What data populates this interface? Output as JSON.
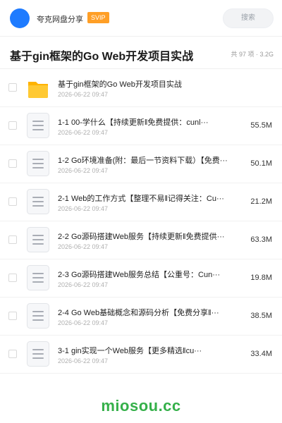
{
  "header": {
    "app_name": "夸克网盘分享",
    "badge": "SVIP",
    "search_placeholder": "搜索"
  },
  "share": {
    "title": "基于gin框架的Go Web开发项目实战",
    "summary": "共 97 项 · 3.2G"
  },
  "files": [
    {
      "type": "folder",
      "icon": "folder-icon",
      "name": "基于gin框架的Go Web开发项目实战",
      "date": "2026-06-22 09:47",
      "size": ""
    },
    {
      "type": "doc",
      "icon": "document-icon",
      "name": "1-1 00-学什么【持续更新‖免费提供：cunl···",
      "date": "2026-06-22 09:47",
      "size": "55.5M"
    },
    {
      "type": "doc",
      "icon": "document-icon",
      "name": "1-2 Go环境准备(附：最后一节资料下载）【免费···",
      "date": "2026-06-22 09:47",
      "size": "50.1M"
    },
    {
      "type": "doc",
      "icon": "document-icon",
      "name": "2-1 Web的工作方式【整理不易‖记得关注：Cu···",
      "date": "2026-06-22 09:47",
      "size": "21.2M"
    },
    {
      "type": "doc",
      "icon": "document-icon",
      "name": "2-2 Go源码搭建Web服务【持续更新‖免费提供···",
      "date": "2026-06-22 09:47",
      "size": "63.3M"
    },
    {
      "type": "doc",
      "icon": "document-icon",
      "name": "2-3 Go源码搭建Web服务总结【公重号：Cun···",
      "date": "2026-06-22 09:47",
      "size": "19.8M"
    },
    {
      "type": "doc",
      "icon": "document-icon",
      "name": "2-4 Go Web基础概念和源码分析【免费分享‖···",
      "date": "2026-06-22 09:47",
      "size": "38.5M"
    },
    {
      "type": "doc",
      "icon": "document-icon",
      "name": "3-1 gin实现一个Web服务【更多精选‖cu···",
      "date": "2026-06-22 09:47",
      "size": "33.4M"
    }
  ],
  "watermark": "miosou.cc",
  "colors": {
    "accent": "#1e7bff",
    "svip": "#ff9f26",
    "folder": "#ffc21a",
    "watermark": "#35b04a"
  }
}
